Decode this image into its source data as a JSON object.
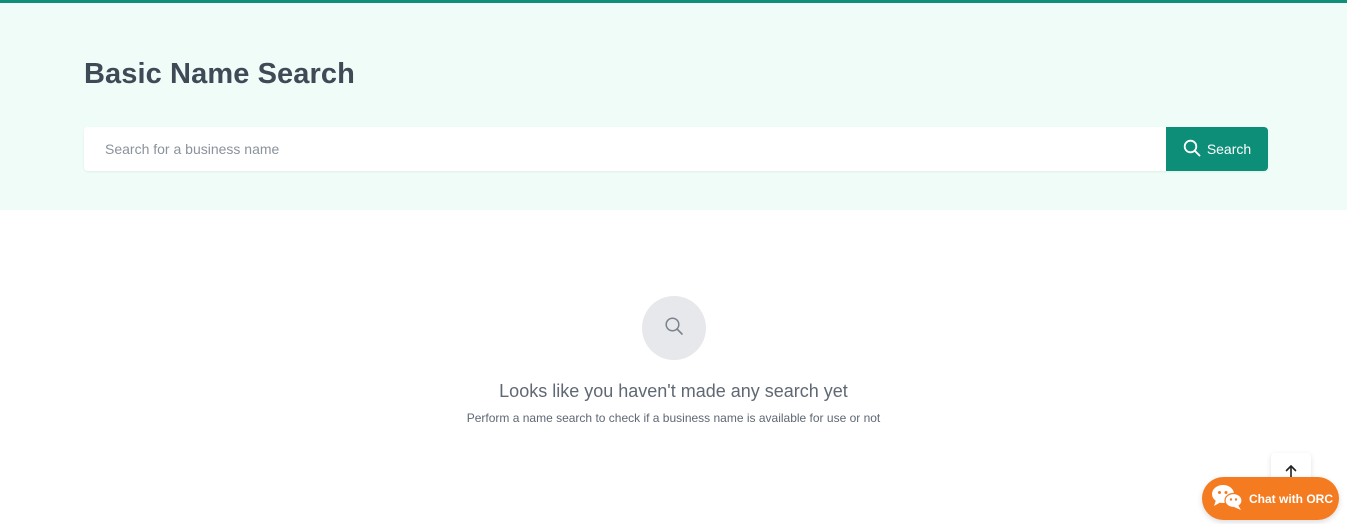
{
  "page": {
    "title": "Basic Name Search"
  },
  "search": {
    "placeholder": "Search for a business name",
    "value": "",
    "button_label": "Search"
  },
  "empty_state": {
    "title": "Looks like you haven't made any search yet",
    "subtitle": "Perform a name search to check if a business name is available for use or not"
  },
  "chat": {
    "label": "Chat with ORC"
  },
  "icons": {
    "search_button": "search-icon",
    "empty_state": "search-icon",
    "back_to_top": "arrow-up-icon",
    "chat": "chat-bubbles-icon"
  },
  "colors": {
    "accent": "#0d8e78",
    "hero_background": "#effcf7",
    "chat_background": "#f47b20",
    "title_text": "#3f4a57"
  }
}
